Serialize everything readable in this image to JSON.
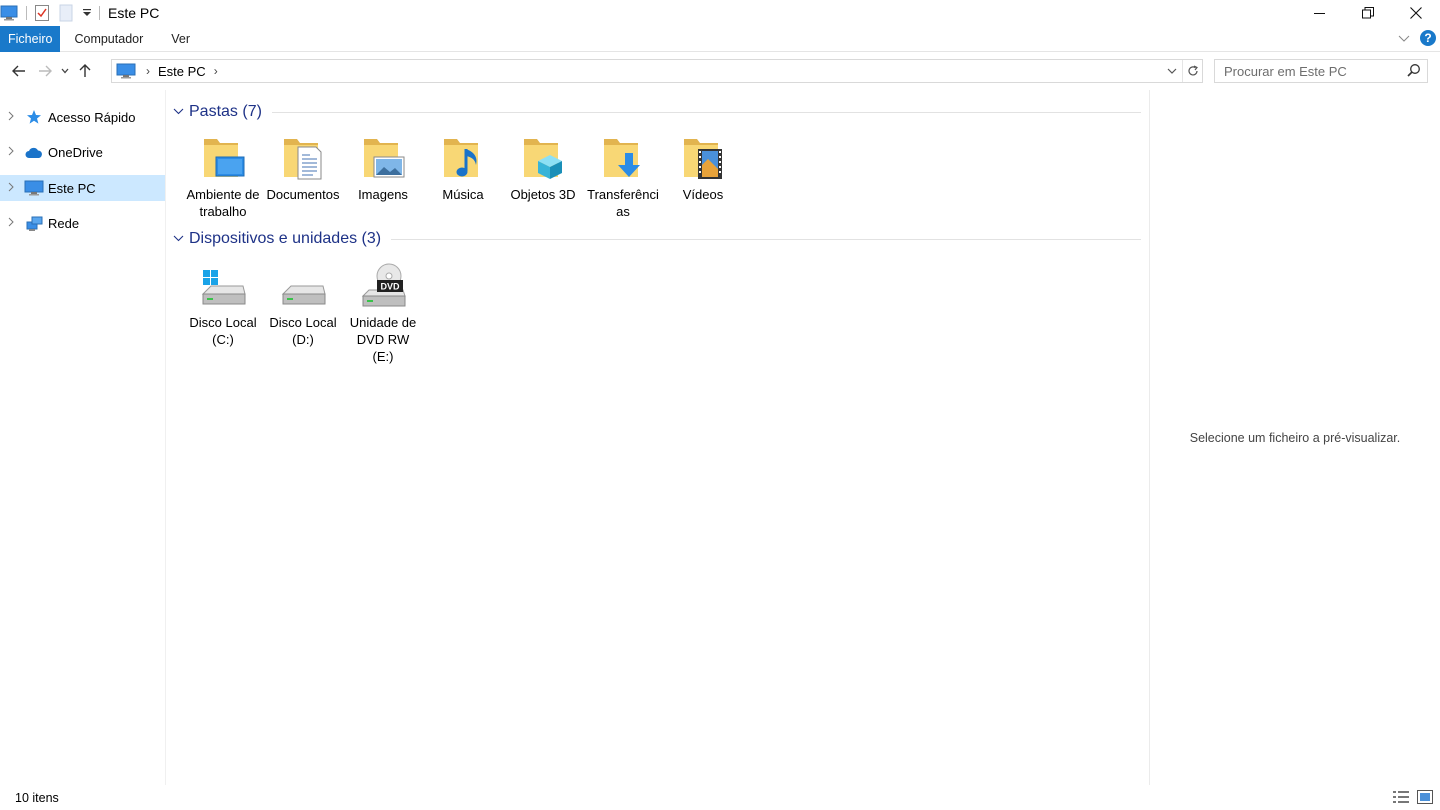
{
  "window": {
    "title": "Este PC",
    "controls": {
      "minimize": "—",
      "restore": "❐",
      "close": "✕"
    }
  },
  "ribbon": {
    "tabs": [
      "Ficheiro",
      "Computador",
      "Ver"
    ]
  },
  "address": {
    "location": "Este PC",
    "separator": "›"
  },
  "search": {
    "placeholder": "Procurar em Este PC"
  },
  "sidebar": {
    "items": [
      {
        "label": "Acesso Rápido",
        "icon": "star-icon"
      },
      {
        "label": "OneDrive",
        "icon": "cloud-icon"
      },
      {
        "label": "Este PC",
        "icon": "computer-icon",
        "selected": true
      },
      {
        "label": "Rede",
        "icon": "network-icon"
      }
    ]
  },
  "groups": {
    "folders": {
      "title": "Pastas (7)",
      "items": [
        {
          "label": "Ambiente de trabalho",
          "icon": "desktop-folder-icon"
        },
        {
          "label": "Documentos",
          "icon": "documents-folder-icon"
        },
        {
          "label": "Imagens",
          "icon": "pictures-folder-icon"
        },
        {
          "label": "Música",
          "icon": "music-folder-icon"
        },
        {
          "label": "Objetos 3D",
          "icon": "3d-objects-folder-icon"
        },
        {
          "label": "Transferências",
          "icon": "downloads-folder-icon"
        },
        {
          "label": "Vídeos",
          "icon": "videos-folder-icon"
        }
      ]
    },
    "devices": {
      "title": "Dispositivos e unidades (3)",
      "items": [
        {
          "label": "Disco Local (C:)",
          "icon": "system-drive-icon"
        },
        {
          "label": "Disco Local (D:)",
          "icon": "hard-drive-icon"
        },
        {
          "label": "Unidade de DVD RW (E:)",
          "icon": "dvd-drive-icon"
        }
      ]
    }
  },
  "preview": {
    "text": "Selecione um ficheiro a pré-visualizar."
  },
  "status": {
    "count": "10 itens"
  },
  "colors": {
    "accent": "#1979ca",
    "selection": "#cce8ff",
    "group_title": "#1e3287",
    "folder": "#f8d775"
  }
}
